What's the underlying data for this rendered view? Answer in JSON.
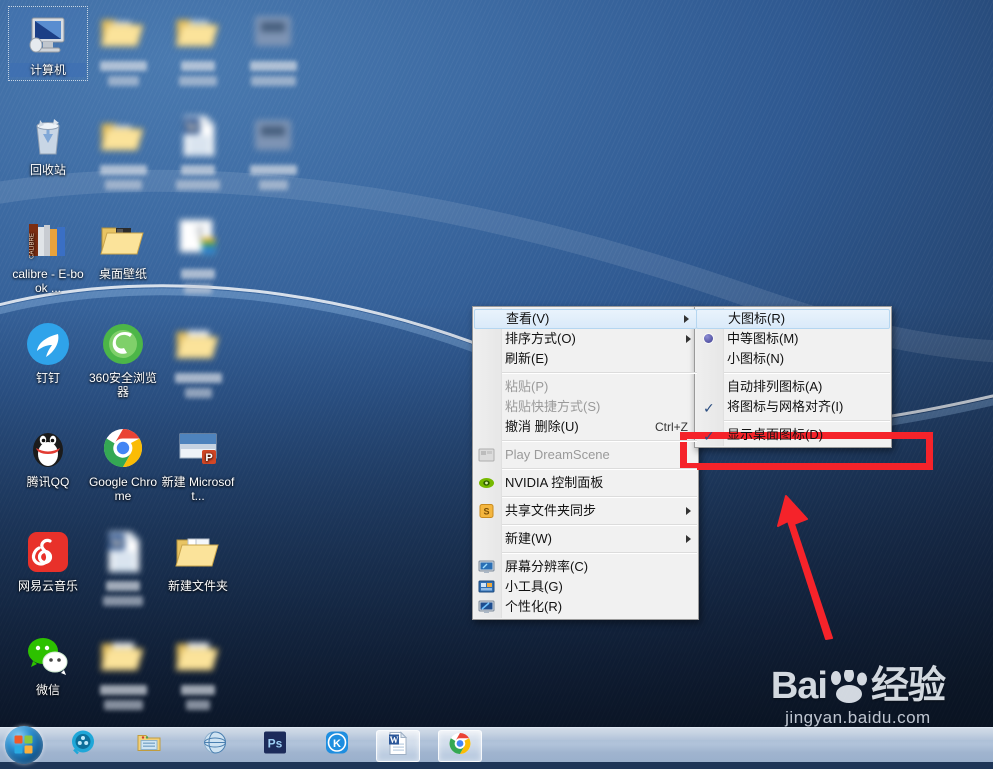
{
  "desktop": {
    "icons": [
      {
        "label": "计算机",
        "art": "computer-icon",
        "selected": true,
        "blurred": false,
        "col": 0,
        "row": 0
      },
      {
        "label": "",
        "art": "folder-icon",
        "selected": false,
        "blurred": true,
        "col": 1,
        "row": 0
      },
      {
        "label": "",
        "art": "folder-picture-icon",
        "selected": false,
        "blurred": true,
        "col": 2,
        "row": 0
      },
      {
        "label": "",
        "art": "blurred-icon",
        "selected": false,
        "blurred": true,
        "col": 3,
        "row": 0
      },
      {
        "label": "回收站",
        "art": "recycle-bin-icon",
        "selected": false,
        "blurred": false,
        "col": 0,
        "row": 1
      },
      {
        "label": "",
        "art": "folder-icon",
        "selected": false,
        "blurred": true,
        "col": 1,
        "row": 1
      },
      {
        "label": "",
        "art": "word-document-icon",
        "selected": false,
        "blurred": true,
        "col": 2,
        "row": 1
      },
      {
        "label": "",
        "art": "blurred-icon",
        "selected": false,
        "blurred": true,
        "col": 3,
        "row": 1
      },
      {
        "label": "calibre - E-book ...",
        "art": "calibre-icon",
        "selected": false,
        "blurred": false,
        "col": 0,
        "row": 2
      },
      {
        "label": "桌面壁纸",
        "art": "folder-book-icon",
        "selected": false,
        "blurred": false,
        "col": 1,
        "row": 2
      },
      {
        "label": "",
        "art": "note-document-icon",
        "selected": false,
        "blurred": true,
        "col": 2,
        "row": 2
      },
      {
        "label": "钉钉",
        "art": "dingtalk-icon",
        "selected": false,
        "blurred": false,
        "col": 0,
        "row": 3
      },
      {
        "label": "360安全浏览器",
        "art": "360-browser-icon",
        "selected": false,
        "blurred": false,
        "col": 1,
        "row": 3
      },
      {
        "label": "",
        "art": "folder-files-icon",
        "selected": false,
        "blurred": true,
        "col": 2,
        "row": 3
      },
      {
        "label": "腾讯QQ",
        "art": "qq-icon",
        "selected": false,
        "blurred": false,
        "col": 0,
        "row": 4
      },
      {
        "label": "Google Chrome",
        "art": "chrome-icon",
        "selected": false,
        "blurred": false,
        "col": 1,
        "row": 4
      },
      {
        "label": "新建 Microsoft...",
        "art": "powerpoint-icon",
        "selected": false,
        "blurred": false,
        "col": 2,
        "row": 4
      },
      {
        "label": "网易云音乐",
        "art": "netease-music-icon",
        "selected": false,
        "blurred": false,
        "col": 0,
        "row": 5
      },
      {
        "label": "",
        "art": "word-document-icon",
        "selected": false,
        "blurred": true,
        "col": 1,
        "row": 5
      },
      {
        "label": "新建文件夹",
        "art": "folder-files-icon",
        "selected": false,
        "blurred": false,
        "col": 2,
        "row": 5
      },
      {
        "label": "微信",
        "art": "wechat-icon",
        "selected": false,
        "blurred": false,
        "col": 0,
        "row": 6
      },
      {
        "label": "",
        "art": "folder-files-icon",
        "selected": false,
        "blurred": true,
        "col": 1,
        "row": 6
      },
      {
        "label": "",
        "art": "folder-files-icon",
        "selected": false,
        "blurred": true,
        "col": 2,
        "row": 6
      }
    ]
  },
  "context_menu": {
    "items": [
      {
        "label": "查看(V)",
        "submenu": true,
        "highlighted": true,
        "disabled": false,
        "accel": "",
        "icon": ""
      },
      {
        "label": "排序方式(O)",
        "submenu": true,
        "highlighted": false,
        "disabled": false,
        "accel": "",
        "icon": ""
      },
      {
        "label": "刷新(E)",
        "submenu": false,
        "highlighted": false,
        "disabled": false,
        "accel": "",
        "icon": ""
      },
      {
        "separator": true
      },
      {
        "label": "粘贴(P)",
        "submenu": false,
        "highlighted": false,
        "disabled": true,
        "accel": "",
        "icon": ""
      },
      {
        "label": "粘贴快捷方式(S)",
        "submenu": false,
        "highlighted": false,
        "disabled": true,
        "accel": "",
        "icon": ""
      },
      {
        "label": "撤消 删除(U)",
        "submenu": false,
        "highlighted": false,
        "disabled": false,
        "accel": "Ctrl+Z",
        "icon": ""
      },
      {
        "separator": true
      },
      {
        "label": "Play DreamScene",
        "submenu": false,
        "highlighted": false,
        "disabled": true,
        "accel": "",
        "icon": "dreamscene-icon"
      },
      {
        "separator": true
      },
      {
        "label": "NVIDIA 控制面板",
        "submenu": false,
        "highlighted": false,
        "disabled": false,
        "accel": "",
        "icon": "nvidia-icon"
      },
      {
        "separator": true
      },
      {
        "label": "共享文件夹同步",
        "submenu": true,
        "highlighted": false,
        "disabled": false,
        "accel": "",
        "icon": "sync-icon"
      },
      {
        "separator": true
      },
      {
        "label": "新建(W)",
        "submenu": true,
        "highlighted": false,
        "disabled": false,
        "accel": "",
        "icon": ""
      },
      {
        "separator": true
      },
      {
        "label": "屏幕分辨率(C)",
        "submenu": false,
        "highlighted": false,
        "disabled": false,
        "accel": "",
        "icon": "screen-resolution-icon"
      },
      {
        "label": "小工具(G)",
        "submenu": false,
        "highlighted": false,
        "disabled": false,
        "accel": "",
        "icon": "gadgets-icon"
      },
      {
        "label": "个性化(R)",
        "submenu": false,
        "highlighted": false,
        "disabled": false,
        "accel": "",
        "icon": "personalize-icon"
      }
    ]
  },
  "view_submenu": {
    "items": [
      {
        "label": "大图标(R)",
        "mark": "none",
        "highlighted": true
      },
      {
        "label": "中等图标(M)",
        "mark": "radio",
        "highlighted": false
      },
      {
        "label": "小图标(N)",
        "mark": "none",
        "highlighted": false
      },
      {
        "separator": true
      },
      {
        "label": "自动排列图标(A)",
        "mark": "none",
        "highlighted": false
      },
      {
        "label": "将图标与网格对齐(I)",
        "mark": "check",
        "highlighted": false
      },
      {
        "separator": true
      },
      {
        "label": "显示桌面图标(D)",
        "mark": "check",
        "highlighted": false
      }
    ],
    "check_glyph": "✓"
  },
  "annotations": {
    "highlight_box_color": "#f5232a",
    "arrow_color": "#f5232a",
    "highlight_target": "显示桌面图标(D)"
  },
  "watermark": {
    "brand": "Bai",
    "brand2": "du",
    "suffix": "经验",
    "url": "jingyan.baidu.com"
  },
  "taskbar": {
    "start_label": "start-orb",
    "buttons": [
      {
        "name": "media-player-icon",
        "active": false
      },
      {
        "name": "windows-explorer-icon",
        "active": false
      },
      {
        "name": "internet-explorer-icon",
        "active": false
      },
      {
        "name": "photoshop-icon",
        "active": false,
        "text": "Ps"
      },
      {
        "name": "kingsoft-icon",
        "active": false,
        "text": "K"
      },
      {
        "name": "word-icon",
        "active": true,
        "text": "W"
      },
      {
        "name": "chrome-icon",
        "active": true,
        "text": ""
      }
    ]
  }
}
